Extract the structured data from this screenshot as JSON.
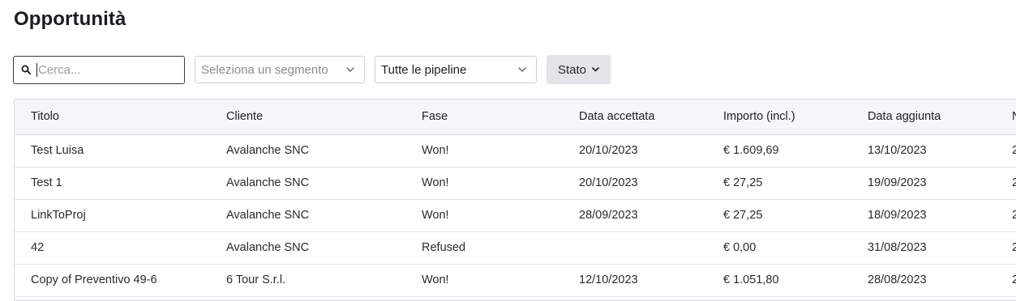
{
  "page": {
    "title": "Opportunità"
  },
  "toolbar": {
    "search_placeholder": "Cerca...",
    "segment_placeholder": "Seleziona un segmento",
    "pipeline_value": "Tutte le pipeline",
    "stato_label": "Stato"
  },
  "icons": {
    "search": "search-icon",
    "chevron": "chevron-down-icon"
  },
  "table": {
    "columns": [
      "Titolo",
      "Cliente",
      "Fase",
      "Data accettata",
      "Importo (incl.)",
      "Data aggiunta",
      "N"
    ],
    "rows": [
      [
        "Test Luisa",
        "Avalanche SNC",
        "Won!",
        "20/10/2023",
        "€ 1.609,69",
        "13/10/2023",
        "2"
      ],
      [
        "Test 1",
        "Avalanche SNC",
        "Won!",
        "20/10/2023",
        "€ 27,25",
        "19/09/2023",
        "2"
      ],
      [
        "LinkToProj",
        "Avalanche SNC",
        "Won!",
        "28/09/2023",
        "€ 27,25",
        "18/09/2023",
        "2"
      ],
      [
        "42",
        "Avalanche SNC",
        "Refused",
        "",
        "€ 0,00",
        "31/08/2023",
        "2"
      ],
      [
        "Copy of Preventivo 49-6",
        "6 Tour S.r.l.",
        "Won!",
        "12/10/2023",
        "€ 1.051,80",
        "28/08/2023",
        "2"
      ]
    ]
  }
}
